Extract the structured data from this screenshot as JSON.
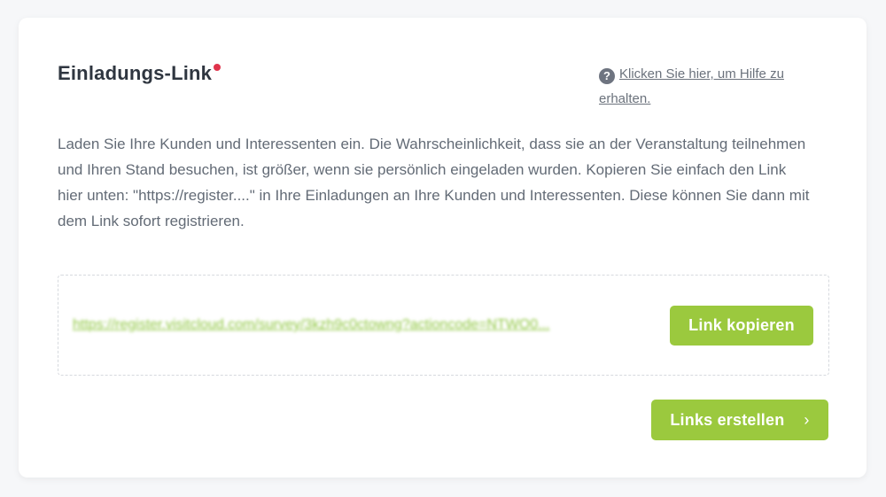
{
  "section": {
    "title": "Einladungs-Link",
    "help_icon": "question-circle-icon",
    "help_link": "Klicken Sie hier, um Hilfe zu erhalten.",
    "description": "Laden Sie Ihre Kunden und Interessenten ein. Die Wahrscheinlichkeit, dass sie an der Veranstaltung teilnehmen und Ihren Stand besuchen, ist größer, wenn sie persönlich eingeladen wurden. Kopieren Sie einfach den Link hier unten: \"https://register....\" in Ihre Einladungen an Ihre Kunden und Interessenten. Diese können Sie dann mit dem Link sofort registrieren."
  },
  "link_box": {
    "url": "https://register.visitcloud.com/survey/3kzh9c0ctowng?actioncode=NTWO0...",
    "copy_label": "Link kopieren"
  },
  "actions": {
    "create_label": "Links erstellen",
    "create_icon": "chevron-right-icon"
  },
  "colors": {
    "accent": "#9bc93e",
    "alert_dot": "#e0334b"
  }
}
